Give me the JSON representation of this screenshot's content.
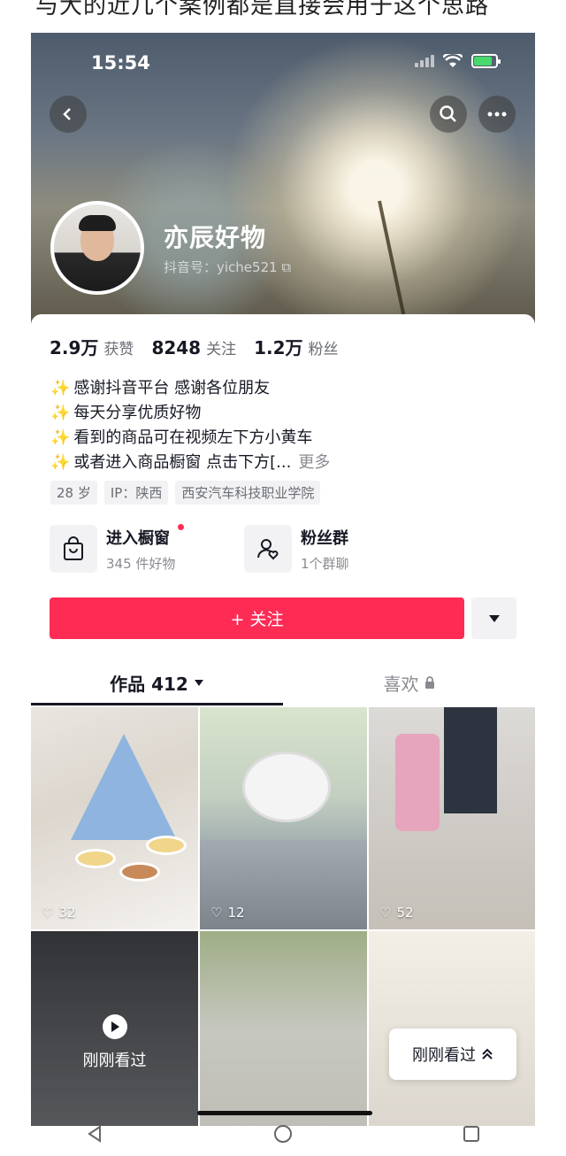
{
  "caption": "与大的近几个案例都是直接会用于这个思路",
  "status": {
    "time": "15:54"
  },
  "header": {
    "back_icon": "back-chevron-icon",
    "search_icon": "search-icon",
    "more_icon": "more-dots-icon"
  },
  "profile": {
    "name": "亦辰好物",
    "id_line": "抖音号：yiche521 ⧉"
  },
  "stats": [
    {
      "value": "2.9万",
      "label": "获赞"
    },
    {
      "value": "8248",
      "label": "关注"
    },
    {
      "value": "1.2万",
      "label": "粉丝"
    }
  ],
  "bio": {
    "lines": [
      "感谢抖音平台  感谢各位朋友",
      "每天分享优质好物",
      "看到的商品可在视频左下方小黄车",
      "或者进入商品橱窗  点击下方[..."
    ],
    "sparkle": "✨",
    "more": "更多"
  },
  "tags": [
    "28 岁",
    "IP：陕西",
    "西安汽车科技职业学院"
  ],
  "features": [
    {
      "title": "进入橱窗",
      "sub": "345 件好物",
      "icon": "shopping-bag-icon"
    },
    {
      "title": "粉丝群",
      "sub": "1个群聊",
      "icon": "fan-group-icon"
    }
  ],
  "follow_button": "+ 关注",
  "tabs": {
    "works": "作品 412",
    "likes": "喜欢"
  },
  "videos": [
    {
      "likes": "32"
    },
    {
      "likes": "12"
    },
    {
      "likes": "52"
    },
    {
      "overlay": "刚刚看过"
    },
    {},
    {}
  ],
  "recently_viewed": "刚刚看过",
  "colors": {
    "accent": "#fe2c55",
    "text": "#161823",
    "muted": "#8a8b91"
  }
}
